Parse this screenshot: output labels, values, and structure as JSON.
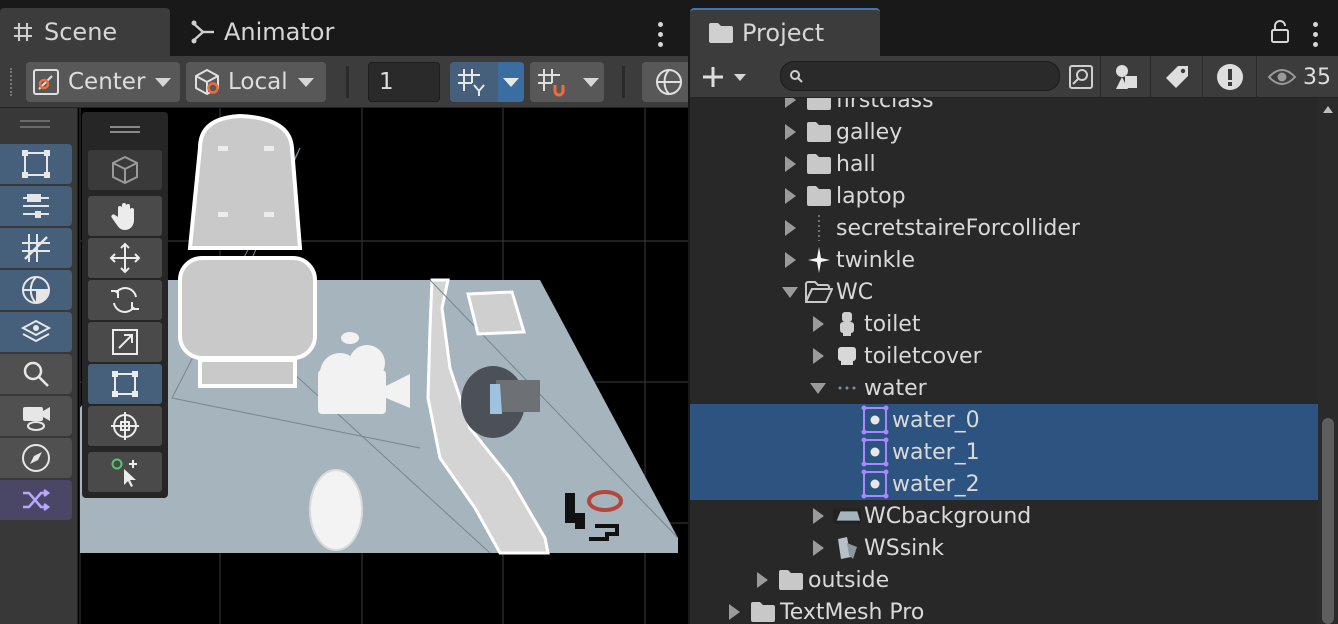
{
  "scene_panel": {
    "tabs": [
      {
        "label": "Scene",
        "icon": "grid-icon",
        "active": true
      },
      {
        "label": "Animator",
        "icon": "animator-icon",
        "active": false
      }
    ],
    "toolbar": {
      "pivot_label": "Center",
      "space_label": "Local",
      "grid_size_value": "1"
    }
  },
  "project_panel": {
    "tab_label": "Project",
    "search": {
      "value": "",
      "placeholder": ""
    },
    "hidden_count": "35",
    "tree": [
      {
        "label": "firstclass",
        "icon": "folder-icon",
        "depth": 0,
        "expanded": false,
        "selected": false
      },
      {
        "label": "galley",
        "icon": "folder-icon",
        "depth": 0,
        "expanded": false,
        "selected": false
      },
      {
        "label": "hall",
        "icon": "folder-icon",
        "depth": 0,
        "expanded": false,
        "selected": false
      },
      {
        "label": "laptop",
        "icon": "folder-icon",
        "depth": 0,
        "expanded": false,
        "selected": false
      },
      {
        "label": "secretstaireForcollider",
        "icon": "sprite-line-icon",
        "depth": 0,
        "expanded": false,
        "selected": false
      },
      {
        "label": "twinkle",
        "icon": "sparkle-icon",
        "depth": 0,
        "expanded": false,
        "selected": false
      },
      {
        "label": "WC",
        "icon": "folder-open-icon",
        "depth": 0,
        "expanded": true,
        "selected": false
      },
      {
        "label": "toilet",
        "icon": "toilet-sprite-icon",
        "depth": 1,
        "expanded": false,
        "selected": false
      },
      {
        "label": "toiletcover",
        "icon": "toiletcover-sprite-icon",
        "depth": 1,
        "expanded": false,
        "selected": false
      },
      {
        "label": "water",
        "icon": "water-sprite-icon",
        "depth": 1,
        "expanded": true,
        "selected": false
      },
      {
        "label": "water_0",
        "icon": "sprite-asset-icon",
        "depth": 2,
        "expanded": null,
        "selected": true
      },
      {
        "label": "water_1",
        "icon": "sprite-asset-icon",
        "depth": 2,
        "expanded": null,
        "selected": true
      },
      {
        "label": "water_2",
        "icon": "sprite-asset-icon",
        "depth": 2,
        "expanded": null,
        "selected": true
      },
      {
        "label": "WCbackground",
        "icon": "wcbackground-sprite-icon",
        "depth": 1,
        "expanded": false,
        "selected": false
      },
      {
        "label": "WSsink",
        "icon": "sink-sprite-icon",
        "depth": 1,
        "expanded": false,
        "selected": false
      },
      {
        "label": "outside",
        "icon": "folder-icon",
        "depth": -1,
        "expanded": false,
        "selected": false
      },
      {
        "label": "TextMesh Pro",
        "icon": "folder-icon",
        "depth": -2,
        "expanded": false,
        "selected": false
      }
    ]
  },
  "colors": {
    "selection": "#2d5480",
    "tool_selected": "#46607c",
    "tab_accent": "#3a79bb",
    "scene_floor": "#a6b4be"
  }
}
